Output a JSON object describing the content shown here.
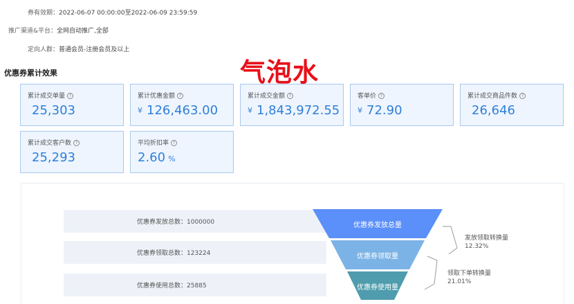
{
  "info": {
    "validity_label": "券有效期：",
    "validity_value": "2022-06-07 00:00:00至2022-06-09 23:59:59",
    "channel_label": "推广渠道&平台：",
    "channel_value": "全网自动推广,全部",
    "audience_label": "定向人群：",
    "audience_value": "普通会员-注册会员及以上"
  },
  "section_title": "优惠券累计效果",
  "watermark": "气泡水",
  "cards": [
    {
      "label": "累计成交单量",
      "currency": "",
      "value": "25,303",
      "unit": ""
    },
    {
      "label": "累计优惠金额",
      "currency": "¥",
      "value": "126,463.00",
      "unit": ""
    },
    {
      "label": "累计成交金额",
      "currency": "¥",
      "value": "1,843,972.55",
      "unit": ""
    },
    {
      "label": "客单价",
      "currency": "¥",
      "value": "72.90",
      "unit": ""
    },
    {
      "label": "累计成交商品件数",
      "currency": "",
      "value": "26,646",
      "unit": ""
    },
    {
      "label": "累计成交客户数",
      "currency": "",
      "value": "25,293",
      "unit": ""
    },
    {
      "label": "平均折扣率",
      "currency": "",
      "value": "2.60",
      "unit": "%"
    }
  ],
  "info_icon": "question-circle-icon",
  "funnel": {
    "rows": [
      {
        "text": "优惠券发放总数：1000000",
        "stage": "优惠券发放总量",
        "color": "#5b8ff9"
      },
      {
        "text": "优惠券领取总数：123224",
        "stage": "优惠券领取量",
        "color": "#7cb3e6"
      },
      {
        "text": "优惠券使用总数：25885",
        "stage": "优惠券使用量",
        "color": "#4e9cad"
      }
    ],
    "conversions": [
      {
        "label": "发放领取转换量",
        "rate": "12.32%"
      },
      {
        "label": "领取下单转换量",
        "rate": "21.01%"
      }
    ]
  }
}
